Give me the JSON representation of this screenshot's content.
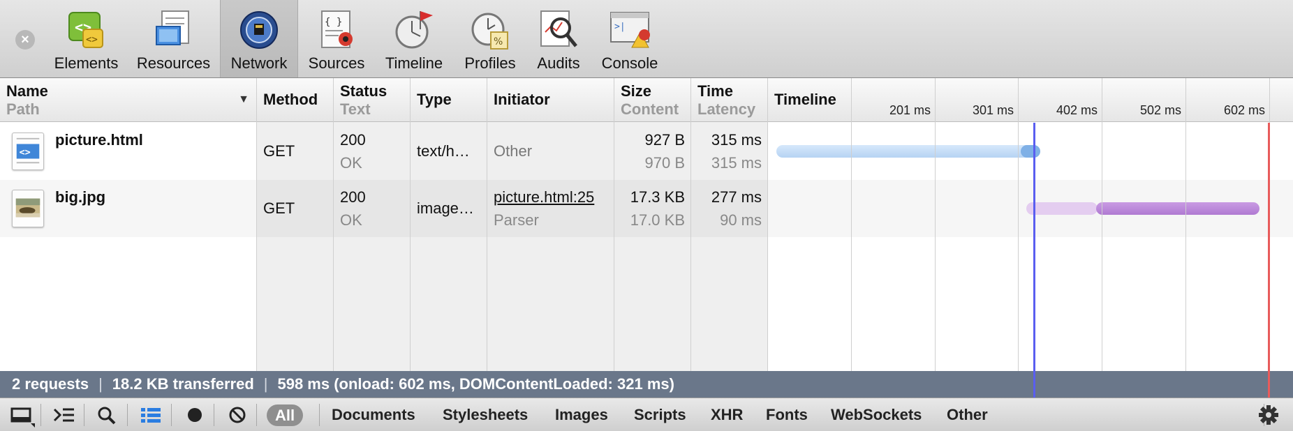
{
  "toolbar": {
    "tabs": [
      {
        "label": "Elements",
        "icon": "elements-icon"
      },
      {
        "label": "Resources",
        "icon": "resources-icon"
      },
      {
        "label": "Network",
        "icon": "network-icon",
        "selected": true
      },
      {
        "label": "Sources",
        "icon": "sources-icon"
      },
      {
        "label": "Timeline",
        "icon": "timeline-icon"
      },
      {
        "label": "Profiles",
        "icon": "profiles-icon"
      },
      {
        "label": "Audits",
        "icon": "audits-icon"
      },
      {
        "label": "Console",
        "icon": "console-icon"
      }
    ]
  },
  "grid": {
    "columns": {
      "name": {
        "main": "Name",
        "sub": "Path"
      },
      "method": {
        "main": "Method"
      },
      "status": {
        "main": "Status",
        "sub": "Text"
      },
      "type": {
        "main": "Type"
      },
      "initiator": {
        "main": "Initiator"
      },
      "size": {
        "main": "Size",
        "sub": "Content"
      },
      "time": {
        "main": "Time",
        "sub": "Latency"
      },
      "timeline": {
        "main": "Timeline"
      }
    },
    "timeline_ticks": [
      "201 ms",
      "301 ms",
      "402 ms",
      "502 ms",
      "602 ms"
    ],
    "rows": [
      {
        "name": "picture.html",
        "icon": "html-document-icon",
        "method": "GET",
        "status": "200",
        "status_text": "OK",
        "type": "text/h…",
        "initiator": "Other",
        "initiator_sub": "",
        "size": "927 B",
        "content": "970 B",
        "time": "315 ms",
        "latency": "315 ms"
      },
      {
        "name": "big.jpg",
        "icon": "image-thumbnail-icon",
        "method": "GET",
        "status": "200",
        "status_text": "OK",
        "type": "image…",
        "initiator": "picture.html:25",
        "initiator_sub": "Parser",
        "size": "17.3 KB",
        "content": "17.0 KB",
        "time": "277 ms",
        "latency": "90 ms"
      }
    ]
  },
  "summary": {
    "requests": "2 requests",
    "transferred": "18.2 KB transferred",
    "timing": "598 ms (onload: 602 ms, DOMContentLoaded: 321 ms)"
  },
  "statusbar": {
    "filters": [
      "All",
      "Documents",
      "Stylesheets",
      "Images",
      "Scripts",
      "XHR",
      "Fonts",
      "WebSockets",
      "Other"
    ],
    "selected_filter": "All",
    "buttons": [
      "dock-icon",
      "console-drawer-icon",
      "search-icon",
      "list-view-icon",
      "record-icon",
      "clear-icon",
      "settings-gear-icon"
    ]
  },
  "colors": {
    "summary_bg": "#6a778a",
    "dom_content_line": "#5a5ef0",
    "load_line": "#e85b5b",
    "document_bar": "#bcd7f5",
    "image_bar": "#b681d6"
  }
}
